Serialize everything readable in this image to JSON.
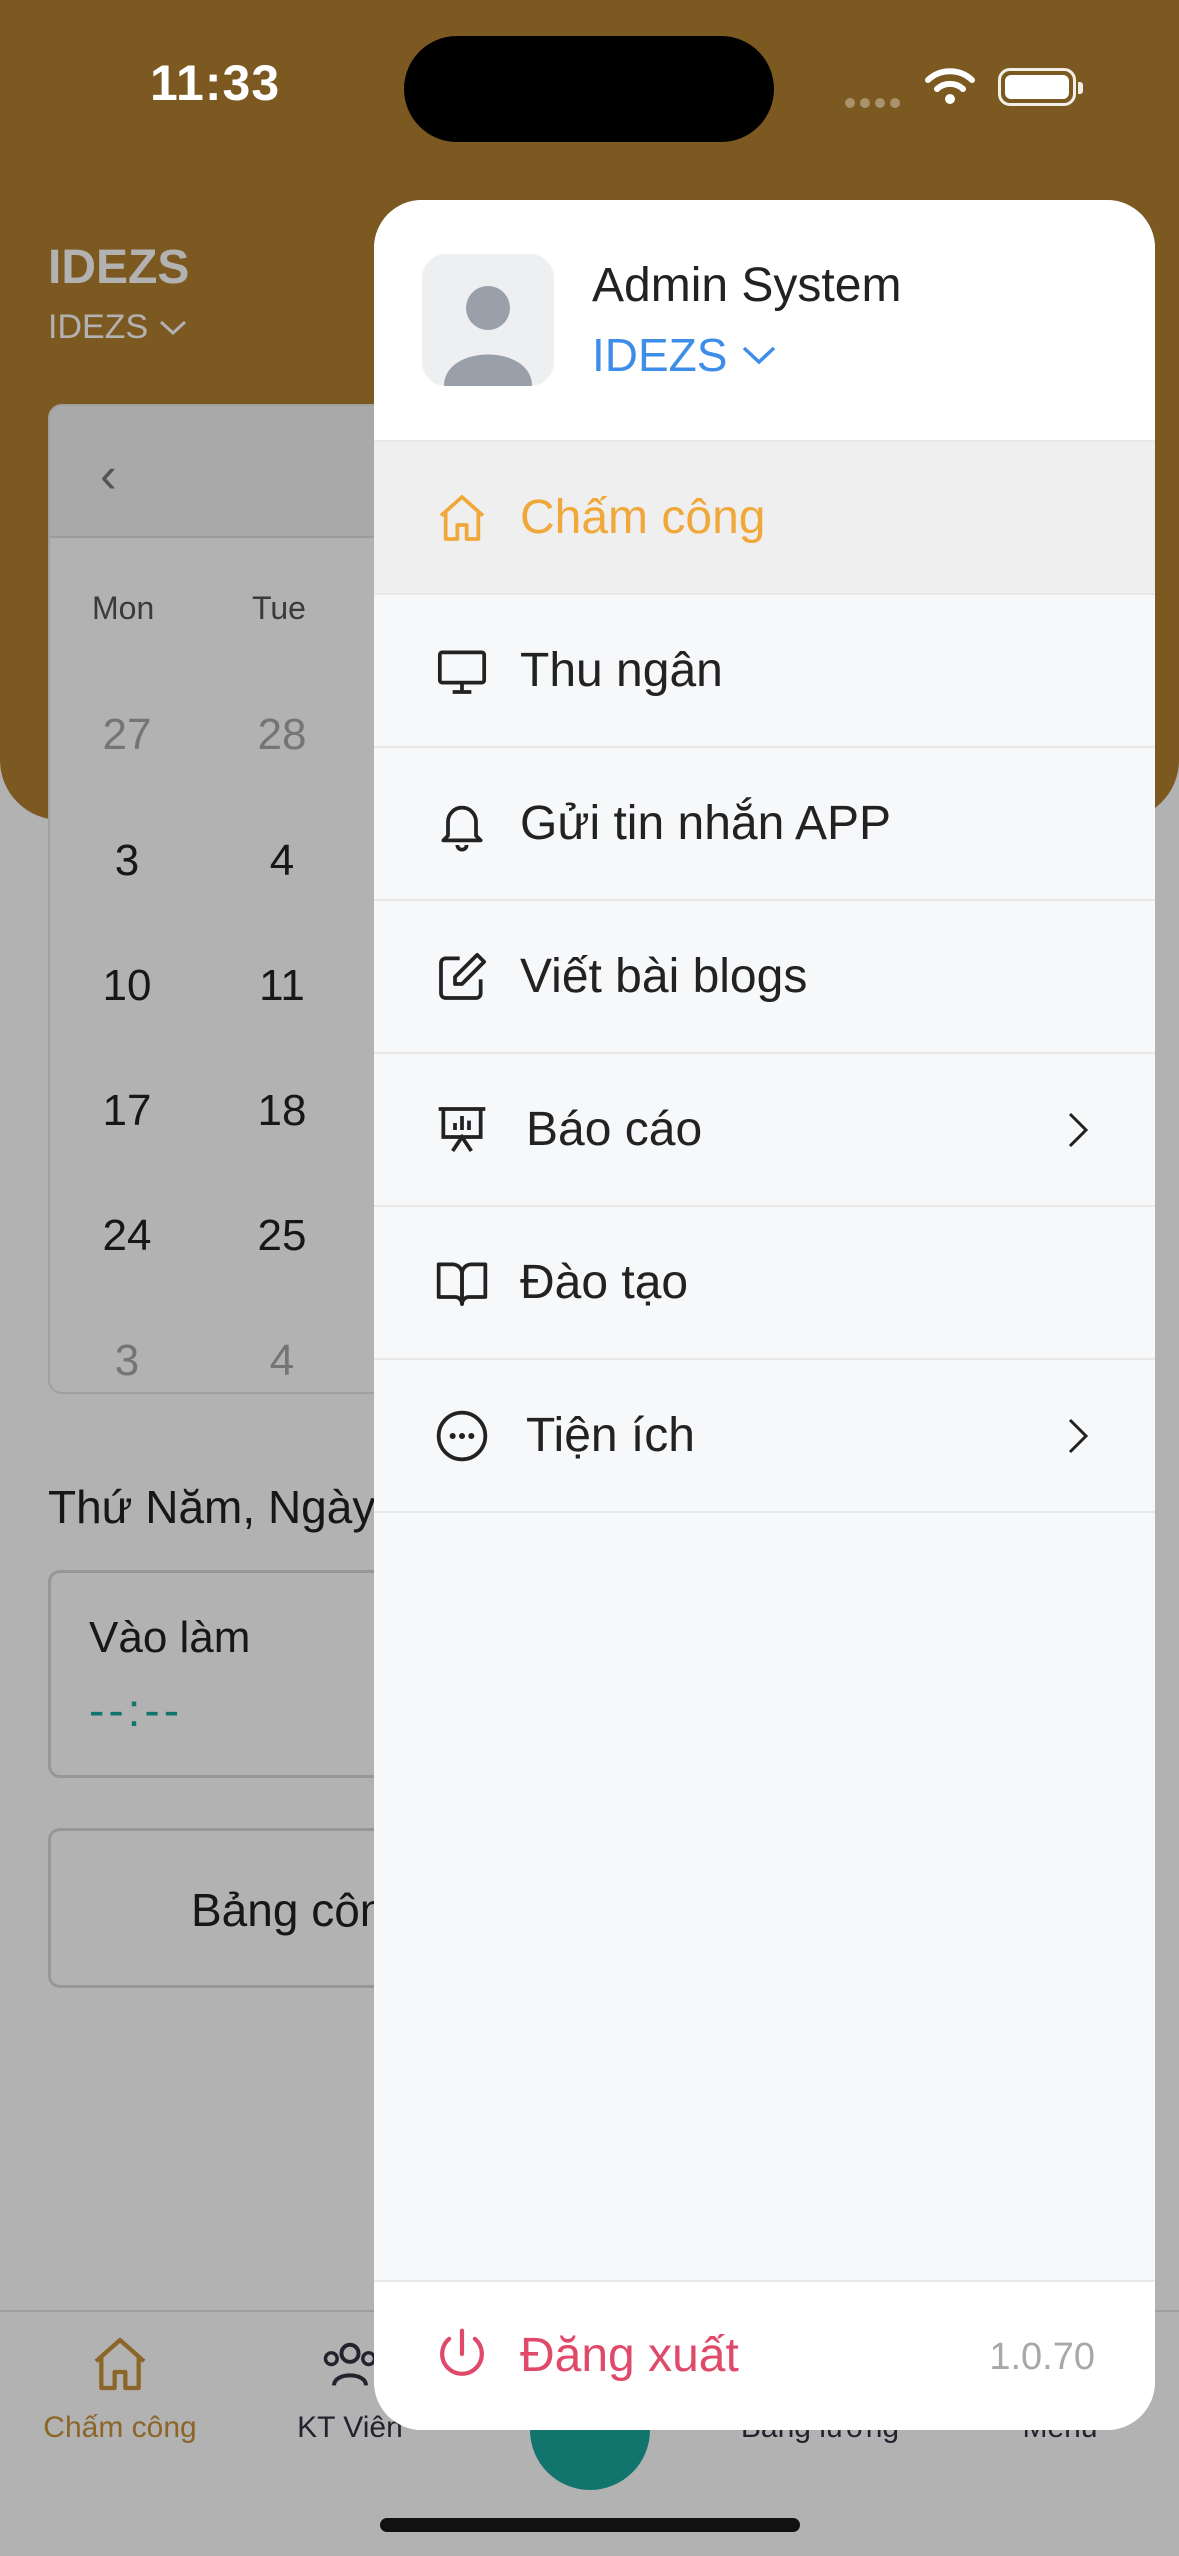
{
  "status_bar": {
    "time": "11:33"
  },
  "header": {
    "company_title": "IDEZS",
    "company_selector": "IDEZS"
  },
  "calendar": {
    "weekdays": [
      "Mon",
      "Tue"
    ],
    "rows": [
      [
        "27",
        "28"
      ],
      [
        "3",
        "4"
      ],
      [
        "10",
        "11"
      ],
      [
        "17",
        "18"
      ],
      [
        "24",
        "25"
      ],
      [
        "3",
        "4"
      ]
    ]
  },
  "main": {
    "date_line": "Thứ Năm, Ngày",
    "checkin_label": "Vào làm",
    "checkin_time": "--:--",
    "table_button": "Bảng côn"
  },
  "tabbar": {
    "tabs": [
      {
        "label": "Chấm công",
        "icon": "home-icon"
      },
      {
        "label": "KT Viên",
        "icon": "users-icon"
      },
      {
        "label": "Bảng lương",
        "icon": "salary-icon"
      },
      {
        "label": "Menu",
        "icon": "menu-icon"
      }
    ]
  },
  "drawer": {
    "user_name": "Admin System",
    "branch": "IDEZS",
    "items": [
      {
        "label": "Chấm công",
        "icon": "home-icon",
        "active": true
      },
      {
        "label": "Thu ngân",
        "icon": "monitor-icon"
      },
      {
        "label": "Gửi tin nhắn APP",
        "icon": "bell-icon"
      },
      {
        "label": "Viết bài blogs",
        "icon": "edit-icon"
      },
      {
        "label": "Báo cáo",
        "icon": "report-icon",
        "has_submenu": true
      },
      {
        "label": "Đào tạo",
        "icon": "book-icon"
      },
      {
        "label": "Tiện ích",
        "icon": "more-icon",
        "has_submenu": true
      }
    ],
    "logout": "Đăng xuất",
    "version": "1.0.70"
  },
  "colors": {
    "brand": "#b0802f",
    "active": "#f0a83a",
    "link": "#3d8ee8",
    "danger": "#e04a6a",
    "teal": "#1aa89c"
  }
}
